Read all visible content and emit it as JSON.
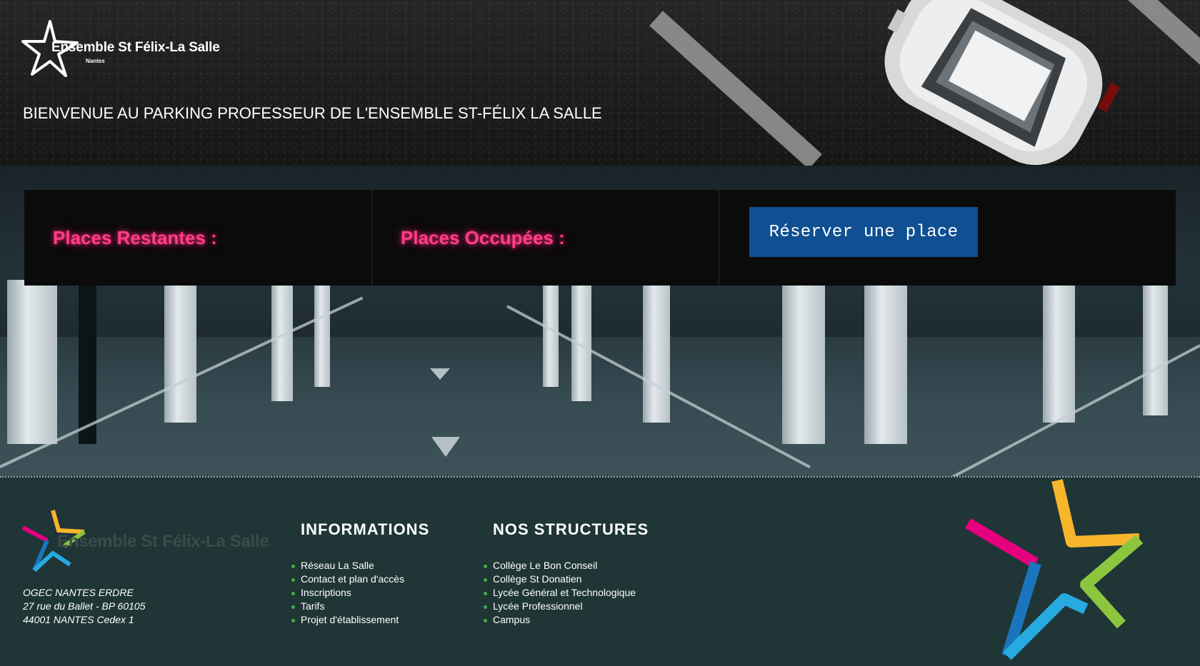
{
  "header": {
    "logo_text": "Ensemble St Félix-La Salle",
    "logo_subtext": "Nantes",
    "welcome": "BIENVENUE AU PARKING PROFESSEUR DE L'ENSEMBLE ST-FÉLIX LA SALLE"
  },
  "status_panel": {
    "remaining_label": "Places Restantes :",
    "occupied_label": "Places Occupées :",
    "reserve_button": "Réserver une place"
  },
  "footer": {
    "logo_text": "Ensemble St Félix-La Salle",
    "address": [
      "OGEC NANTES ERDRE",
      "27 rue du Ballet - BP 60105",
      "44001 NANTES Cedex 1"
    ],
    "informations": {
      "title": "INFORMATIONS",
      "links": [
        "Réseau La Salle",
        "Contact et plan d'accès",
        "Inscriptions",
        "Tarifs",
        "Projet d'établissement"
      ]
    },
    "structures": {
      "title": "NOS STRUCTURES",
      "links": [
        "Collège Le Bon Conseil",
        "Collège St Donatien",
        "Lycée Général et Technologique",
        "Lycée Professionnel",
        "Campus"
      ]
    }
  },
  "colors": {
    "accent_pink": "#ff3f88",
    "button_blue": "#0f4f92",
    "footer_bg": "#1f3536",
    "bullet_green": "#3fae49"
  },
  "icons": [
    "star-logo-icon",
    "colorful-star-icon",
    "car-image",
    "bullet-icon"
  ]
}
